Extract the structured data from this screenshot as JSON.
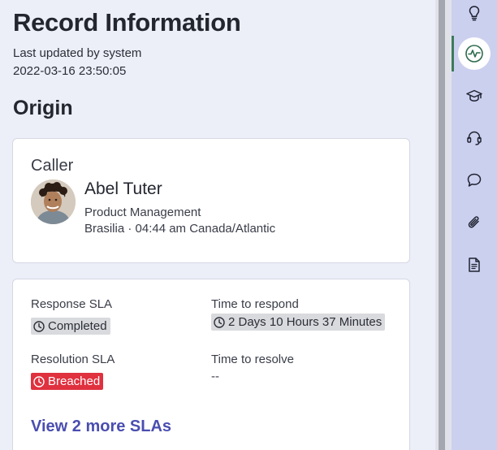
{
  "record": {
    "title": "Record Information",
    "updated_by": "Last updated by system",
    "updated_at": "2022-03-16 23:50:05"
  },
  "origin": {
    "title": "Origin",
    "caller_label": "Caller",
    "caller_name": "Abel Tuter",
    "department": "Product Management",
    "location": "Brasilia · 04:44 am Canada/Atlantic"
  },
  "sla": {
    "response_label": "Response SLA",
    "response_status": "Completed",
    "time_to_respond_label": "Time to respond",
    "time_to_respond_value": "2 Days 10 Hours 37 Minutes",
    "resolution_label": "Resolution SLA",
    "resolution_status": "Breached",
    "time_to_resolve_label": "Time to resolve",
    "time_to_resolve_value": "--",
    "more_link": "View 2 more SLAs"
  },
  "rail_icons": [
    "lightbulb-icon",
    "activity-icon",
    "graduation-cap-icon",
    "headset-icon",
    "chat-bubble-icon",
    "paperclip-icon",
    "document-icon"
  ],
  "colors": {
    "accent_link": "#4a4eb0",
    "breached": "#e0313f",
    "completed_badge": "#d9dadd",
    "rail_background": "#ccd0ef",
    "active_indicator": "#3d7a5c"
  }
}
